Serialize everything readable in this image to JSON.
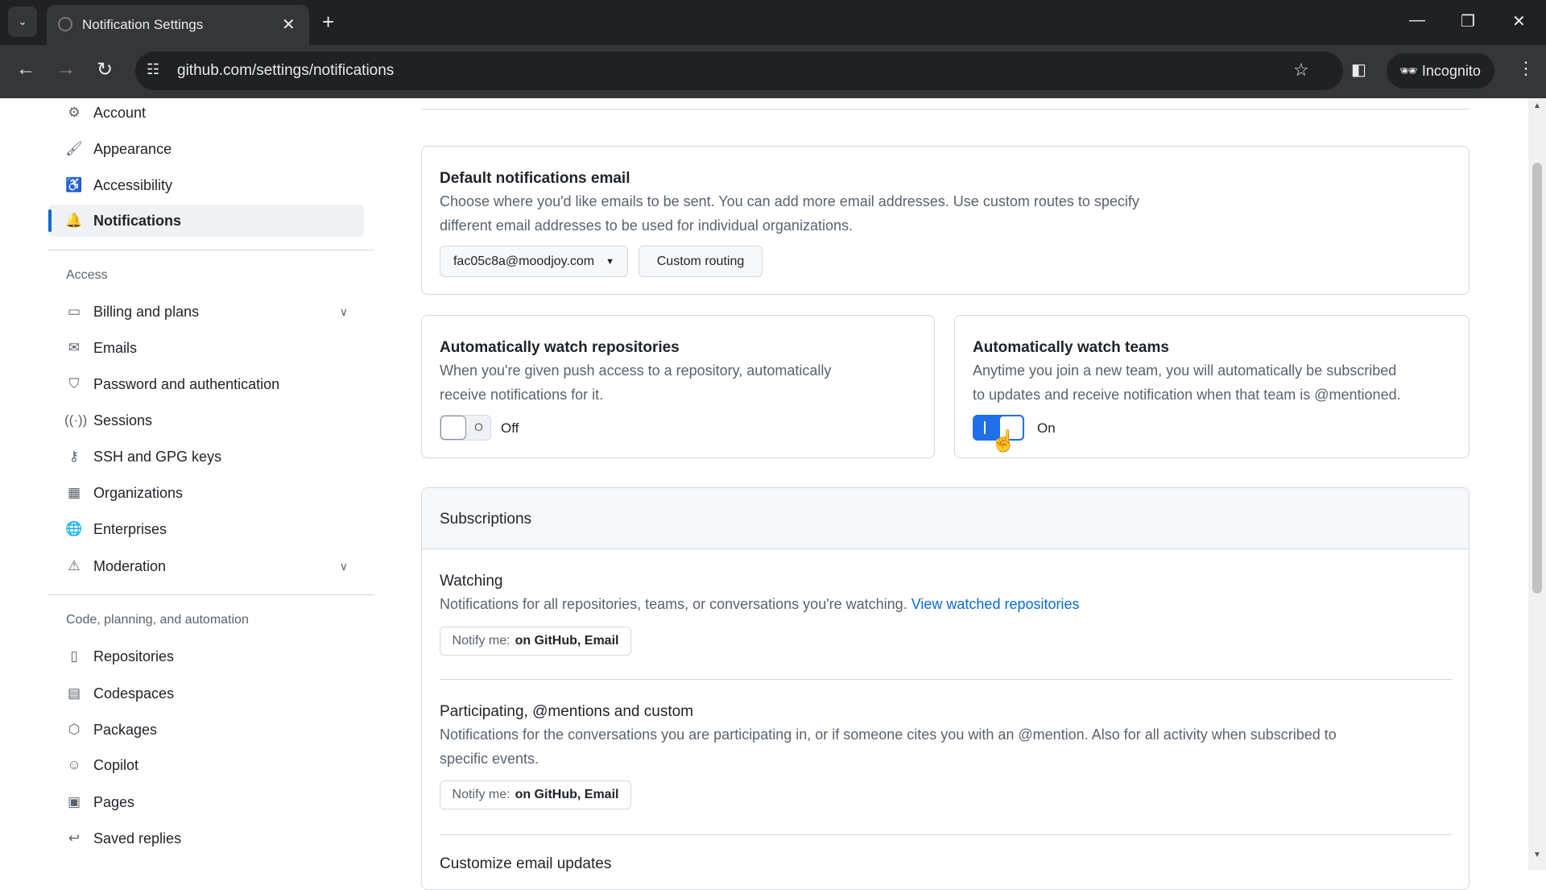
{
  "browser": {
    "tab_title": "Notification Settings",
    "url": "github.com/settings/notifications",
    "incognito_label": "Incognito"
  },
  "sidebar": {
    "top_items": [
      {
        "label": "Account",
        "icon": "gear-icon"
      },
      {
        "label": "Appearance",
        "icon": "paintbrush-icon"
      },
      {
        "label": "Accessibility",
        "icon": "accessibility-icon"
      },
      {
        "label": "Notifications",
        "icon": "bell-icon",
        "active": true
      }
    ],
    "access_heading": "Access",
    "access_items": [
      {
        "label": "Billing and plans",
        "icon": "credit-card-icon",
        "expandable": true
      },
      {
        "label": "Emails",
        "icon": "mail-icon"
      },
      {
        "label": "Password and authentication",
        "icon": "shield-icon"
      },
      {
        "label": "Sessions",
        "icon": "broadcast-icon"
      },
      {
        "label": "SSH and GPG keys",
        "icon": "key-icon"
      },
      {
        "label": "Organizations",
        "icon": "organization-icon"
      },
      {
        "label": "Enterprises",
        "icon": "globe-icon"
      },
      {
        "label": "Moderation",
        "icon": "report-icon",
        "expandable": true
      }
    ],
    "code_heading": "Code, planning, and automation",
    "code_items": [
      {
        "label": "Repositories",
        "icon": "repo-icon"
      },
      {
        "label": "Codespaces",
        "icon": "codespaces-icon"
      },
      {
        "label": "Packages",
        "icon": "package-icon"
      },
      {
        "label": "Copilot",
        "icon": "copilot-icon"
      },
      {
        "label": "Pages",
        "icon": "browser-icon"
      },
      {
        "label": "Saved replies",
        "icon": "reply-icon"
      }
    ]
  },
  "email": {
    "title": "Default notifications email",
    "desc1": "Choose where you'd like emails to be sent. You can add more email addresses. Use custom routes to specify",
    "desc2": "different email addresses to be used for individual organizations.",
    "selected": "fac05c8a@moodjoy.com",
    "custom_routing": "Custom routing"
  },
  "watch_repos": {
    "title": "Automatically watch repositories",
    "desc1": "When you're given push access to a repository, automatically",
    "desc2": "receive notifications for it.",
    "state": "Off"
  },
  "watch_teams": {
    "title": "Automatically watch teams",
    "desc1": "Anytime you join a new team, you will automatically be subscribed",
    "desc2": "to updates and receive notification when that team is @mentioned.",
    "state": "On"
  },
  "subscriptions": {
    "title": "Subscriptions",
    "watching": {
      "title": "Watching",
      "desc": "Notifications for all repositories, teams, or conversations you're watching.",
      "link": "View watched repositories",
      "notify_label": "Notify me:",
      "notify_value": "on GitHub, Email"
    },
    "participating": {
      "title": "Participating, @mentions and custom",
      "desc1": "Notifications for the conversations you are participating in, or if someone cites you with an @mention. Also for all activity when subscribed to",
      "desc2": "specific events.",
      "notify_label": "Notify me:",
      "notify_value": "on GitHub, Email"
    },
    "customize_title": "Customize email updates"
  },
  "colors": {
    "accent": "#0969da",
    "toggle_on": "#1f6feb"
  }
}
